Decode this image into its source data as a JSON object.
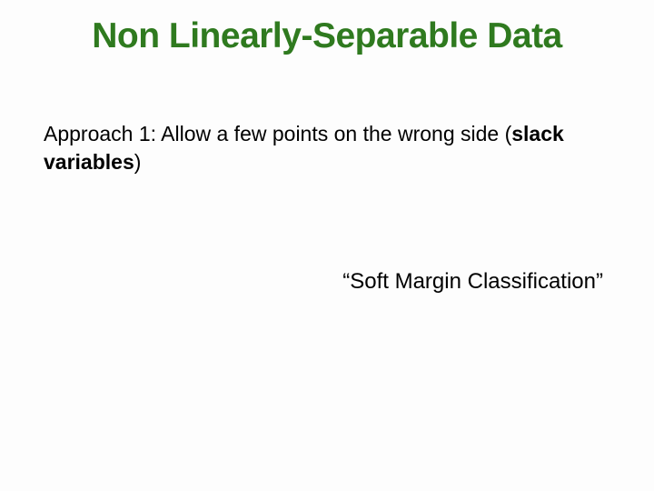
{
  "title": "Non Linearly-Separable Data",
  "approach": {
    "lead": "Approach 1:  Allow a few points on the wrong side (",
    "bold": "slack variables",
    "tail": ")"
  },
  "quote": "“Soft Margin Classification”"
}
